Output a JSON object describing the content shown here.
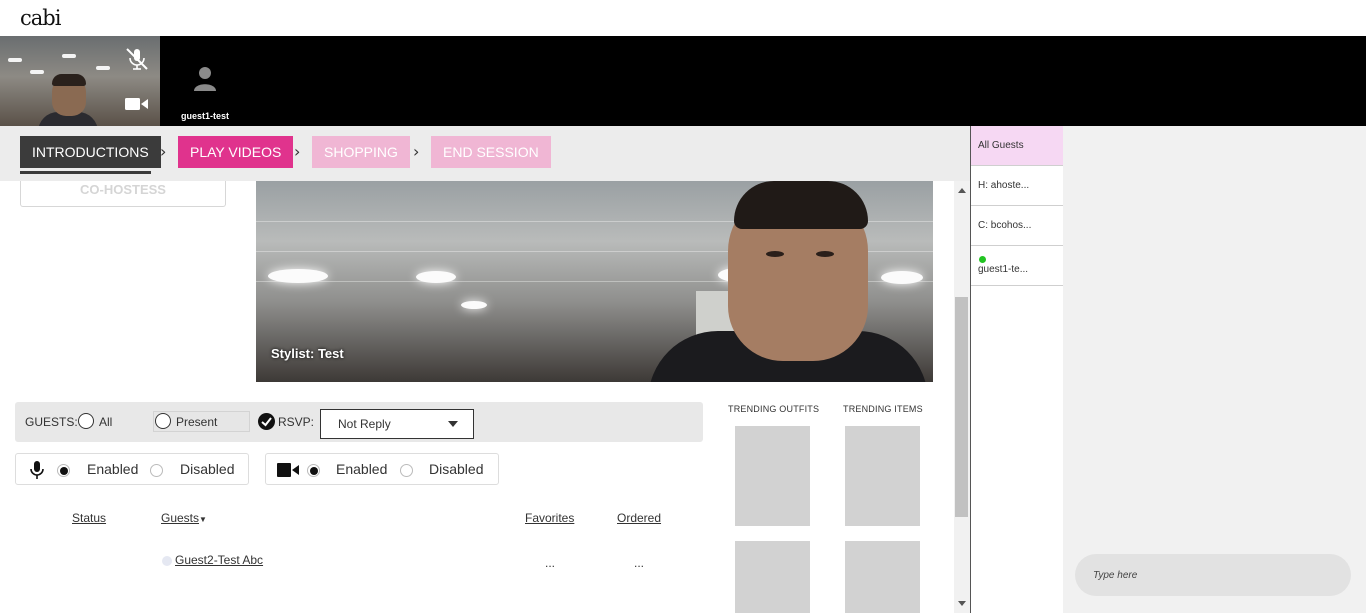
{
  "app": {
    "logo": "cabi"
  },
  "video_strip": {
    "self_tile": {
      "mic_icon": "mic-off-icon",
      "camera_icon": "video-camera-icon"
    },
    "guest_tile": {
      "name": "guest1-test",
      "icon": "user-avatar-icon"
    }
  },
  "steps": [
    {
      "label": "INTRODUCTIONS",
      "state": "active",
      "color": "#3b3b3b"
    },
    {
      "label": "PLAY VIDEOS",
      "state": "enabled",
      "color": "#e0338d"
    },
    {
      "label": "SHOPPING",
      "state": "disabled",
      "color": "#f0b6d4"
    },
    {
      "label": "END SESSION",
      "state": "disabled",
      "color": "#f0b6d4"
    }
  ],
  "cohost_button": "CO-HOSTESS",
  "stylist_video": {
    "label": "Stylist: Test"
  },
  "guest_filter": {
    "label": "GUESTS:",
    "all_label": "All",
    "present_label": "Present",
    "rsvp_label": "RSVP:",
    "rsvp_checked": true,
    "rsvp_selected": "Not Reply"
  },
  "audio_toggle": {
    "icon": "microphone-icon",
    "enabled_label": "Enabled",
    "disabled_label": "Disabled",
    "selected": "Enabled"
  },
  "video_toggle": {
    "icon": "video-camera-icon",
    "enabled_label": "Enabled",
    "disabled_label": "Disabled",
    "selected": "Enabled"
  },
  "guest_table": {
    "columns": [
      "Status",
      "Guests",
      "Favorites",
      "Ordered"
    ],
    "rows": [
      {
        "status": "",
        "guest": "Guest2-Test Abc",
        "favorites": "...",
        "ordered": "..."
      }
    ]
  },
  "trending": {
    "outfits_title": "TRENDING OUTFITS",
    "items_title": "TRENDING ITEMS"
  },
  "guest_list": [
    {
      "label": "All Guests",
      "active": true,
      "online": false
    },
    {
      "label": "H: ahoste...",
      "active": false,
      "online": false
    },
    {
      "label": "C: bcohos...",
      "active": false,
      "online": false
    },
    {
      "label": "guest1-te...",
      "active": false,
      "online": true
    }
  ],
  "chat": {
    "placeholder": "Type here"
  },
  "colors": {
    "accent_pink": "#e0338d",
    "light_pink": "#f0b6d4",
    "active_tab_bg": "#f6d8f3",
    "online": "#22c422"
  }
}
